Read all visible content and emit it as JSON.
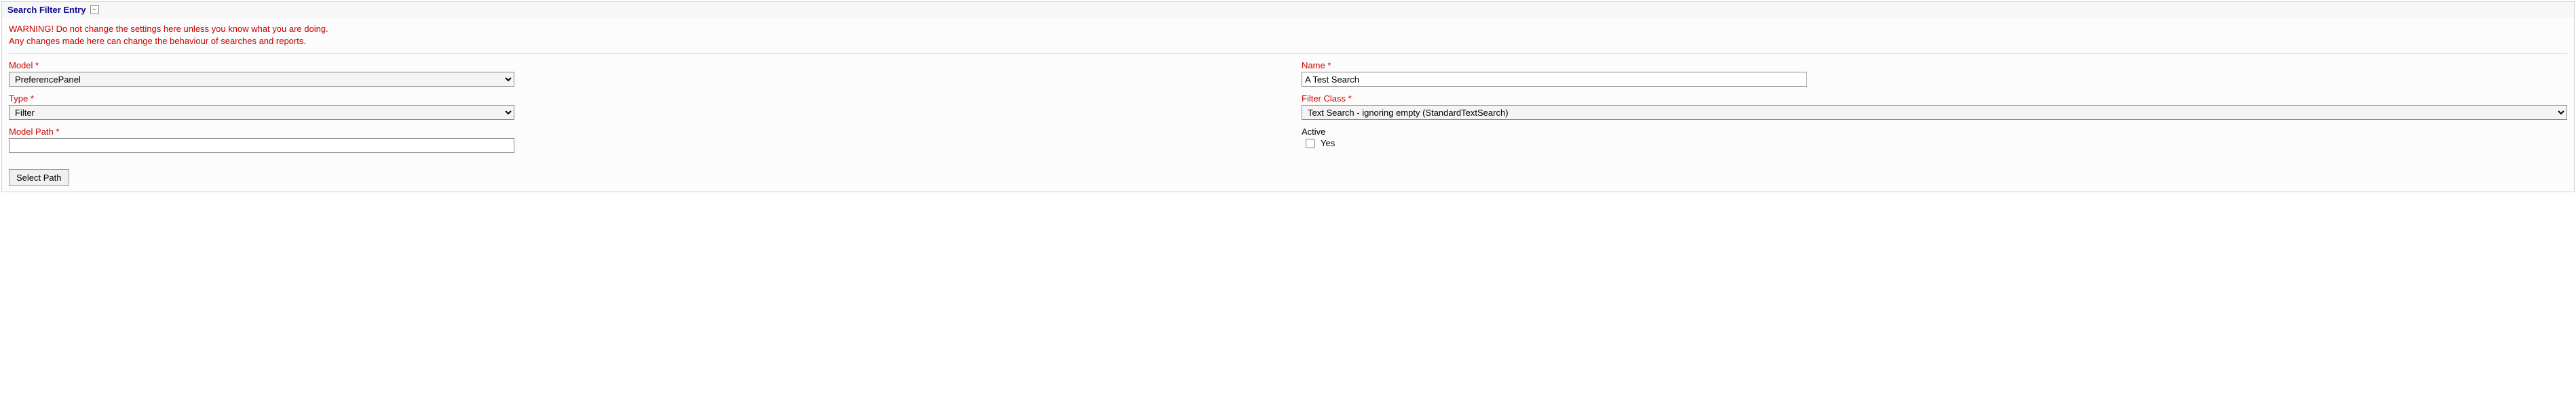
{
  "panel": {
    "title": "Search Filter Entry",
    "collapse_symbol": "−"
  },
  "warning": {
    "line1": "WARNING! Do not change the settings here unless you know what you are doing.",
    "line2": "Any changes made here can change the behaviour of searches and reports."
  },
  "fields": {
    "model": {
      "label": "Model",
      "required": "*",
      "value": "PreferencePanel"
    },
    "name": {
      "label": "Name",
      "required": "*",
      "value": "A Test Search"
    },
    "type": {
      "label": "Type",
      "required": "*",
      "value": "Filter"
    },
    "filter_class": {
      "label": "Filter Class",
      "required": "*",
      "value": "Text Search - ignoring empty (StandardTextSearch)"
    },
    "model_path": {
      "label": "Model Path",
      "required": "*",
      "value": ""
    },
    "active": {
      "label": "Active",
      "option": "Yes",
      "checked": false
    }
  },
  "buttons": {
    "select_path": "Select Path"
  }
}
